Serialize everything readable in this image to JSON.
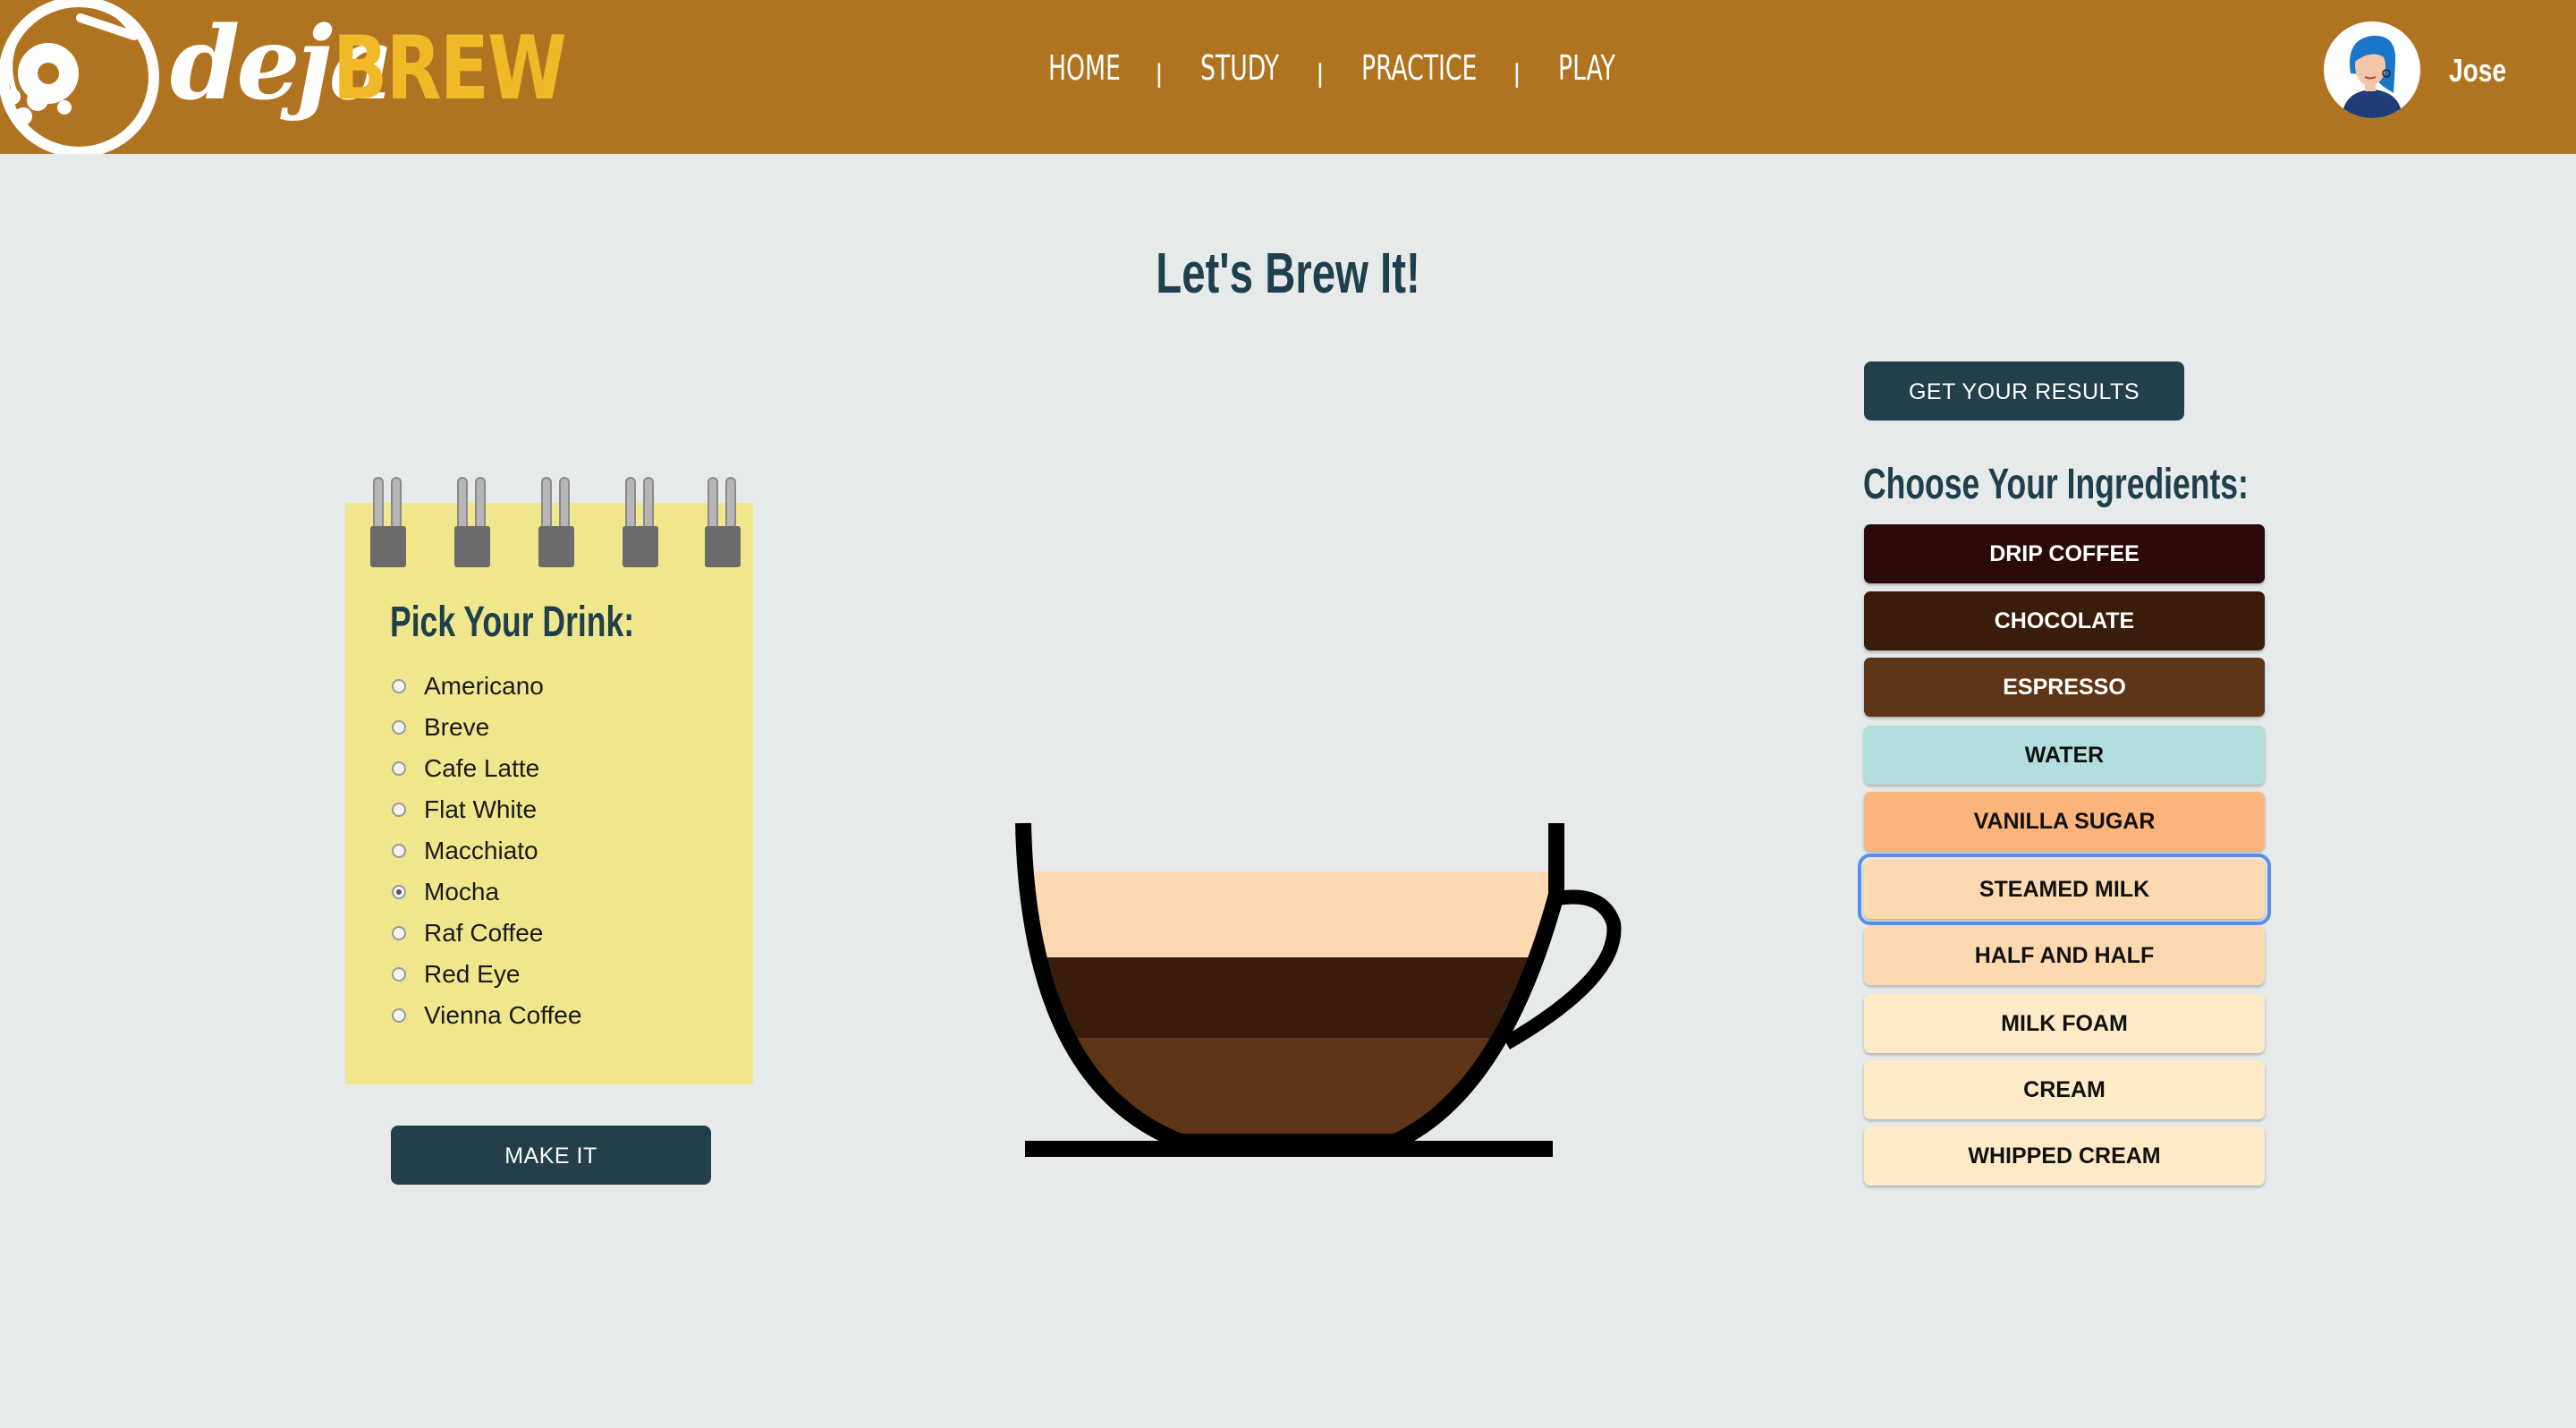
{
  "header": {
    "logo_deja": "deja",
    "logo_brew": "BREW",
    "nav": [
      "HOME",
      "STUDY",
      "PRACTICE",
      "PLAY"
    ],
    "nav_separator": "|",
    "username": "Jose"
  },
  "main": {
    "title": "Let's Brew It!"
  },
  "drink_picker": {
    "title": "Pick Your Drink:",
    "options": [
      "Americano",
      "Breve",
      "Cafe Latte",
      "Flat White",
      "Macchiato",
      "Mocha",
      "Raf Coffee",
      "Red Eye",
      "Vienna Coffee"
    ],
    "selected": "Mocha",
    "make_it_label": "MAKE IT"
  },
  "ingredients": {
    "results_label": "GET YOUR RESULTS",
    "title": "Choose Your Ingredients:",
    "items": [
      {
        "label": "DRIP COFFEE",
        "bg": "#2b0a0a",
        "fg": "#ffffff"
      },
      {
        "label": "CHOCOLATE",
        "bg": "#3a1c0c",
        "fg": "#ffffff"
      },
      {
        "label": "ESPRESSO",
        "bg": "#5f3518",
        "fg": "#ffffff"
      },
      {
        "label": "WATER",
        "bg": "#b3dee0",
        "fg": "#111111"
      },
      {
        "label": "VANILLA SUGAR",
        "bg": "#fcb47b",
        "fg": "#111111"
      },
      {
        "label": "STEAMED MILK",
        "bg": "#fdd9b1",
        "fg": "#111111"
      },
      {
        "label": "HALF AND HALF",
        "bg": "#fdd9b1",
        "fg": "#111111"
      },
      {
        "label": "MILK FOAM",
        "bg": "#fdebc8",
        "fg": "#111111"
      },
      {
        "label": "CREAM",
        "bg": "#fdebc8",
        "fg": "#111111"
      },
      {
        "label": "WHIPPED CREAM",
        "bg": "#fdebc8",
        "fg": "#111111"
      }
    ],
    "focused": "STEAMED MILK"
  },
  "cup": {
    "layers_top_to_bottom": [
      {
        "ingredient": "Steamed Milk",
        "color": "#fdd9b1"
      },
      {
        "ingredient": "Chocolate",
        "color": "#3a1c0c"
      },
      {
        "ingredient": "Espresso",
        "color": "#5f3518"
      }
    ]
  },
  "colors": {
    "header": "#b07421",
    "accent_dark": "#223f4a",
    "notepad": "#f0e68c",
    "background": "#e6eaea"
  }
}
